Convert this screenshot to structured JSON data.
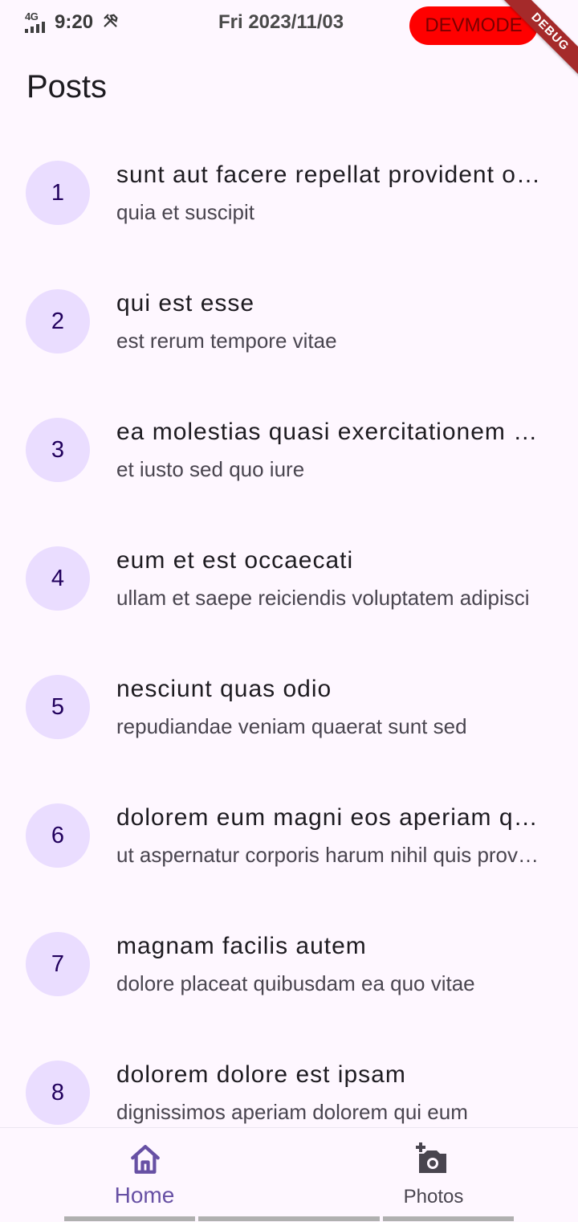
{
  "status_bar": {
    "network": "4G",
    "time": "9:20",
    "date": "Fri 2023/11/03",
    "devmode_label": "DEVMODE",
    "debug_banner": "DEBUG"
  },
  "page": {
    "title": "Posts"
  },
  "posts": [
    {
      "id": "1",
      "title": "sunt aut facere repellat provident occaecati excepturi optio reprehenderit",
      "body": "quia et suscipit"
    },
    {
      "id": "2",
      "title": "qui est esse",
      "body": "est rerum tempore vitae"
    },
    {
      "id": "3",
      "title": "ea molestias quasi exercitationem repellat qui ipsa sit aut",
      "body": "et iusto sed quo iure"
    },
    {
      "id": "4",
      "title": "eum et est occaecati",
      "body": "ullam et saepe reiciendis voluptatem adipisci"
    },
    {
      "id": "5",
      "title": "nesciunt quas odio",
      "body": "repudiandae veniam quaerat sunt sed"
    },
    {
      "id": "6",
      "title": "dolorem eum magni eos aperiam quia",
      "body": "ut aspernatur corporis harum nihil quis provident sequi"
    },
    {
      "id": "7",
      "title": "magnam facilis autem",
      "body": "dolore placeat quibusdam ea quo vitae"
    },
    {
      "id": "8",
      "title": "dolorem dolore est ipsam",
      "body": "dignissimos aperiam dolorem qui eum"
    }
  ],
  "bottom_nav": {
    "home_label": "Home",
    "home_icon": "home-icon",
    "photos_label": "Photos",
    "photos_icon": "add-photo-icon",
    "active_color": "#6750a4",
    "inactive_color": "#49454f"
  },
  "colors": {
    "background": "#fef7ff",
    "avatar_bg": "#eaddff",
    "avatar_text": "#21005d",
    "devmode_bg": "#ff0000",
    "debug_banner_bg": "#a52a2a"
  }
}
